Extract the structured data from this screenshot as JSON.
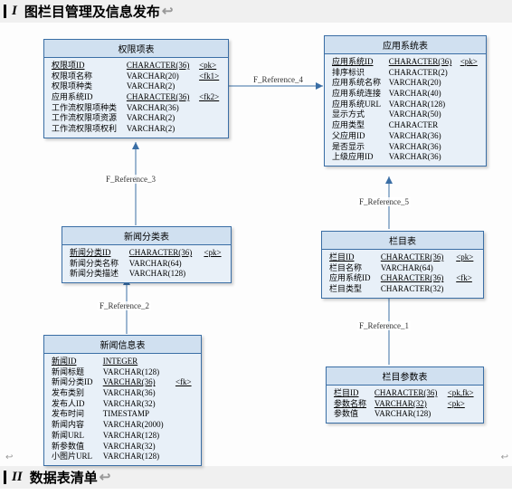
{
  "section1": {
    "num": "I",
    "title": "图栏目管理及信息发布"
  },
  "section2": {
    "num": "II",
    "title": "数据表清单"
  },
  "refs": {
    "r1": "F_Reference_1",
    "r2": "F_Reference_2",
    "r3": "F_Reference_3",
    "r4": "F_Reference_4",
    "r5": "F_Reference_5"
  },
  "entities": {
    "permission": {
      "title": "权限项表",
      "rows": [
        [
          "权限项ID",
          "CHARACTER(36)",
          "<pk>",
          true,
          true
        ],
        [
          "权限项名称",
          "VARCHAR(20)",
          "<fk1>",
          false,
          false
        ],
        [
          "权限项种类",
          "VARCHAR(2)",
          "",
          false,
          false
        ],
        [
          "应用系统ID",
          "CHARACTER(36)",
          "<fk2>",
          false,
          true
        ],
        [
          "工作流权限项种类",
          "VARCHAR(36)",
          "",
          false,
          false
        ],
        [
          "工作流权限项资源",
          "VARCHAR(2)",
          "",
          false,
          false
        ],
        [
          "工作流权限项权利",
          "VARCHAR(2)",
          "",
          false,
          false
        ]
      ]
    },
    "appsys": {
      "title": "应用系统表",
      "rows": [
        [
          "应用系统ID",
          "CHARACTER(36)",
          "<pk>",
          true,
          true
        ],
        [
          "排序标识",
          "CHARACTER(2)",
          "",
          false,
          false
        ],
        [
          "应用系统名称",
          "VARCHAR(20)",
          "",
          false,
          false
        ],
        [
          "应用系统连接",
          "VARCHAR(40)",
          "",
          false,
          false
        ],
        [
          "应用系统URL",
          "VARCHAR(128)",
          "",
          false,
          false
        ],
        [
          "显示方式",
          "VARCHAR(50)",
          "",
          false,
          false
        ],
        [
          "应用类型",
          "CHARACTER",
          "",
          false,
          false
        ],
        [
          "父应用ID",
          "VARCHAR(36)",
          "",
          false,
          false
        ],
        [
          "是否显示",
          "VARCHAR(36)",
          "",
          false,
          false
        ],
        [
          "上级应用ID",
          "VARCHAR(36)",
          "",
          false,
          false
        ]
      ]
    },
    "newscat": {
      "title": "新闻分类表",
      "rows": [
        [
          "新闻分类ID",
          "CHARACTER(36)",
          "<pk>",
          true,
          true
        ],
        [
          "新闻分类名称",
          "VARCHAR(64)",
          "",
          false,
          false
        ],
        [
          "新闻分类描述",
          "VARCHAR(128)",
          "",
          false,
          false
        ]
      ]
    },
    "column": {
      "title": "栏目表",
      "rows": [
        [
          "栏目ID",
          "CHARACTER(36)",
          "<pk>",
          true,
          true
        ],
        [
          "栏目名称",
          "VARCHAR(64)",
          "",
          false,
          false
        ],
        [
          "应用系统ID",
          "CHARACTER(36)",
          "<fk>",
          false,
          true
        ],
        [
          "栏目类型",
          "CHARACTER(32)",
          "",
          false,
          false
        ]
      ]
    },
    "newsinfo": {
      "title": "新闻信息表",
      "rows": [
        [
          "新闻ID",
          "INTEGER",
          "",
          true,
          true
        ],
        [
          "新闻标题",
          "VARCHAR(128)",
          "",
          false,
          false
        ],
        [
          "新闻分类ID",
          "VARCHAR(36)",
          "<fk>",
          false,
          true
        ],
        [
          "发布类别",
          "VARCHAR(36)",
          "",
          false,
          false
        ],
        [
          "发布人ID",
          "VARCHAR(32)",
          "",
          false,
          false
        ],
        [
          "发布时间",
          "TIMESTAMP",
          "",
          false,
          false
        ],
        [
          "新闻内容",
          "VARCHAR(2000)",
          "",
          false,
          false
        ],
        [
          "新闻URL",
          "VARCHAR(128)",
          "",
          false,
          false
        ],
        [
          "新参数值",
          "VARCHAR(32)",
          "",
          false,
          false
        ],
        [
          "小图片URL",
          "VARCHAR(128)",
          "",
          false,
          false
        ]
      ]
    },
    "colparam": {
      "title": "栏目参数表",
      "rows": [
        [
          "栏目ID",
          "CHARACTER(36)",
          "<pk,fk>",
          true,
          true
        ],
        [
          "参数名称",
          "VARCHAR(32)",
          "<pk>",
          true,
          true
        ],
        [
          "参数值",
          "VARCHAR(128)",
          "",
          false,
          false
        ]
      ]
    }
  }
}
